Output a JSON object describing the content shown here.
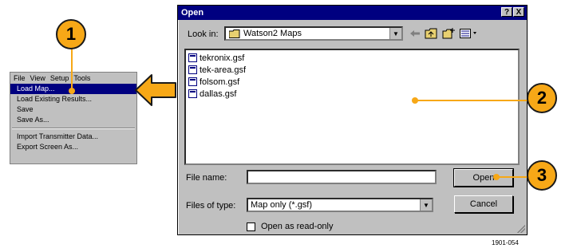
{
  "callouts": [
    "1",
    "2",
    "3"
  ],
  "menu": {
    "bar": [
      "File",
      "View",
      "Setup",
      "Tools"
    ],
    "items": [
      "Load Map...",
      "Load Existing Results...",
      "Save",
      "Save As..."
    ],
    "items2": [
      "Import Transmitter Data...",
      "Export Screen As..."
    ],
    "selected_index": 0
  },
  "dialog": {
    "title": "Open",
    "help_btn": "?",
    "close_btn": "X",
    "look_in_label": "Look in:",
    "look_in_value": "Watson2 Maps",
    "files": [
      "tekronix.gsf",
      "tek-area.gsf",
      "folsom.gsf",
      "dallas.gsf"
    ],
    "file_name_label": "File name:",
    "file_name_value": "",
    "files_of_type_label": "Files of type:",
    "files_of_type_value": "Map only (*.gsf)",
    "open_button": "Open",
    "cancel_button": "Cancel",
    "read_only_label": "Open as read-only",
    "read_only_checked": false
  },
  "figure_id": "1901-054",
  "colors": {
    "callout": "#f7a817",
    "titlebar": "#000080",
    "dialog_bg": "#c0c0c0"
  }
}
